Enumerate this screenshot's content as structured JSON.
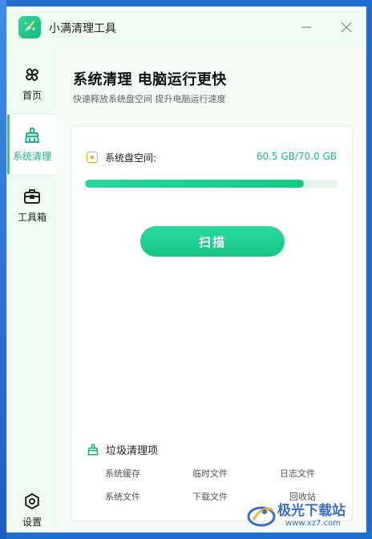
{
  "app": {
    "title": "小满清理工具",
    "logo_icon": "broom-sparkle-icon",
    "accent": "#1fcf8f"
  },
  "sidebar": {
    "items": [
      {
        "label": "首页",
        "icon": "clover-icon"
      },
      {
        "label": "系统清理",
        "icon": "broom-icon",
        "active": true
      },
      {
        "label": "工具箱",
        "icon": "toolbox-icon"
      },
      {
        "label": "设置",
        "icon": "gear-icon"
      }
    ]
  },
  "main": {
    "title": "系统清理 电脑运行更快",
    "subtitle": "快速释放系统盘空间 提升电脑运行速度",
    "disk": {
      "label": "系统盘空间:",
      "value": "60.5 GB/70.0 GB",
      "used_fraction": 0.864
    },
    "scan_label": "扫描",
    "junk": {
      "title": "垃圾清理项",
      "items": [
        "系统缓存",
        "临时文件",
        "日志文件",
        "系统文件",
        "下载文件",
        "回收站"
      ]
    }
  },
  "watermark": {
    "text": "极光下载站",
    "url": "www.xz7.com"
  }
}
